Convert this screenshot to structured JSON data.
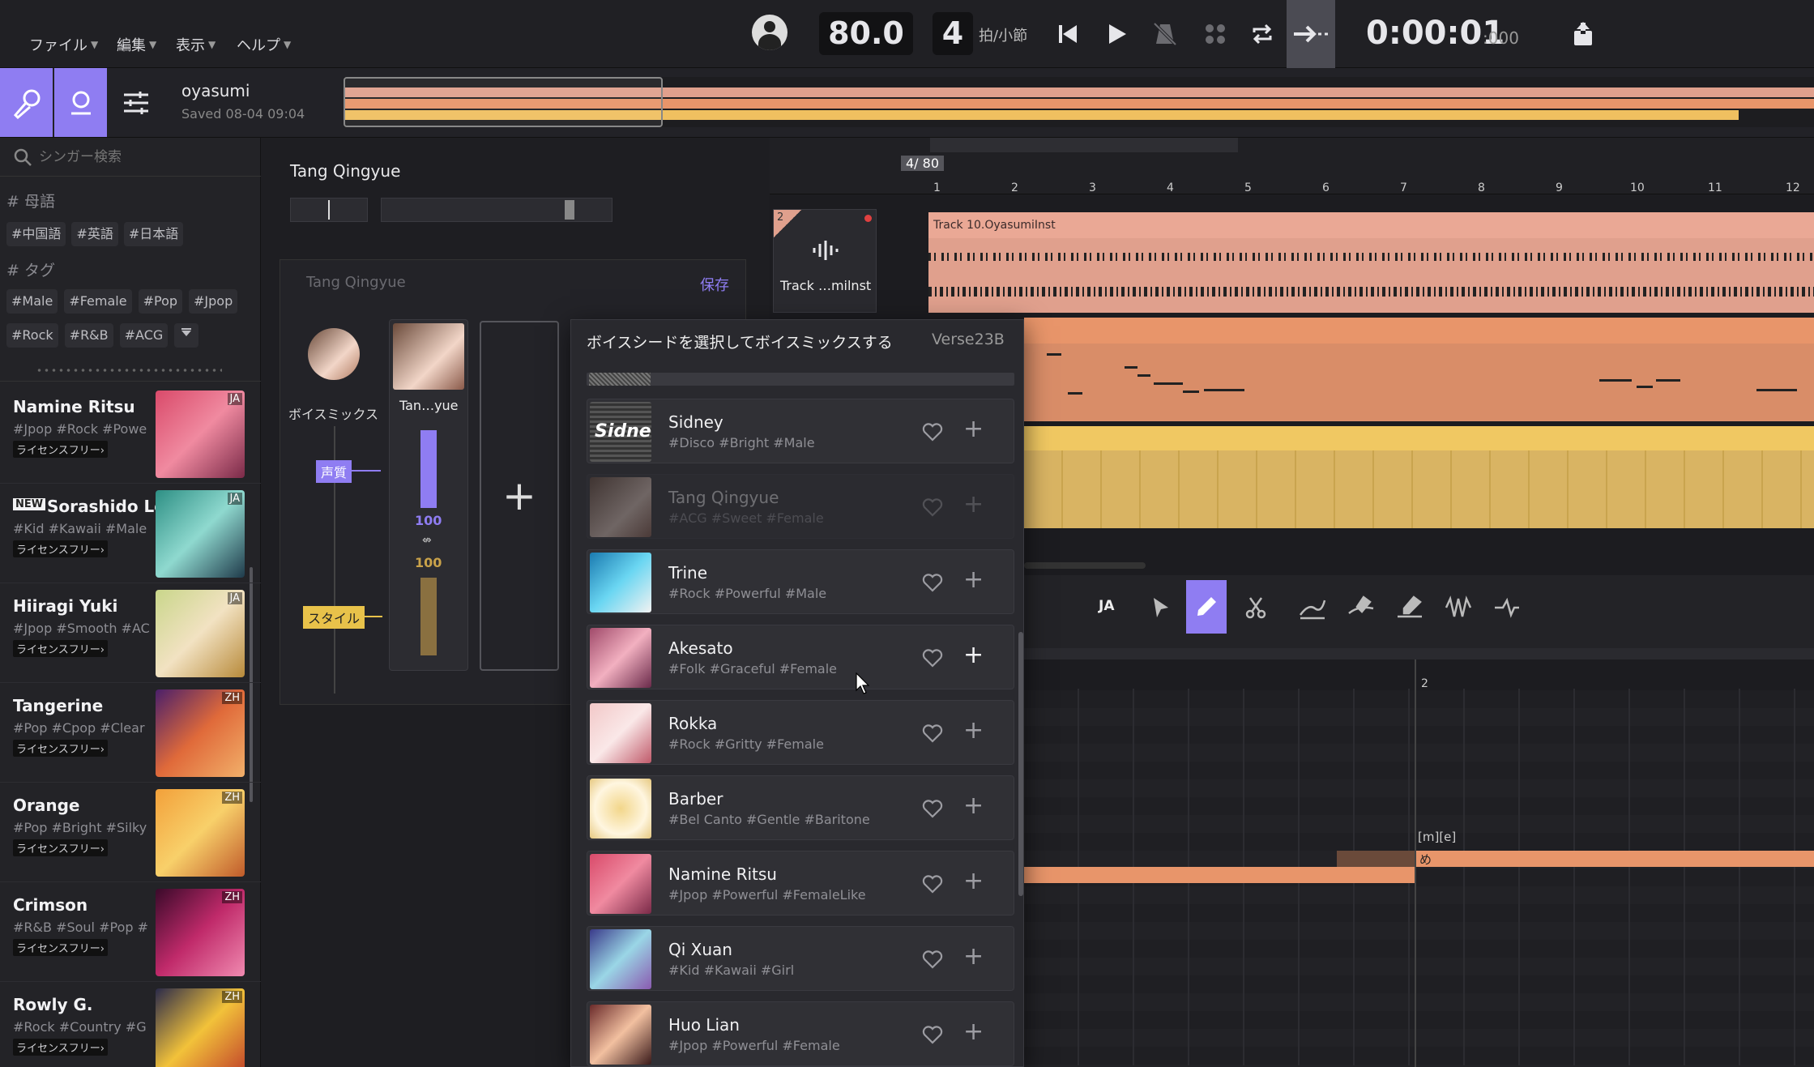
{
  "menu": {
    "file": "ファイル",
    "edit": "編集",
    "view": "表示",
    "help": "ヘルプ"
  },
  "transport": {
    "tempo": "80.0",
    "beats": "4",
    "beats_unit": "拍/小節",
    "time": "0:00:01",
    "time_sub": ":000"
  },
  "project": {
    "title": "oyasumi",
    "saved": "Saved 08-04 09:04"
  },
  "search": {
    "placeholder": "シンガー検索"
  },
  "filters": {
    "language_heading": "# 母語",
    "languages": [
      "#中国語",
      "#英語",
      "#日本語"
    ],
    "tag_heading": "# タグ",
    "tags_row1": [
      "#Male",
      "#Female",
      "#Pop",
      "#Jpop"
    ],
    "tags_row2": [
      "#Rock",
      "#R&B",
      "#ACG"
    ]
  },
  "singers": [
    {
      "name": "Namine Ritsu",
      "tags": "#Jpop #Rock #Powe",
      "license": "ライセンスフリー›",
      "lang": "JA",
      "new": ""
    },
    {
      "name": "Sorashido Le",
      "tags": "#Kid #Kawaii #Male",
      "license": "ライセンスフリー›",
      "lang": "JA",
      "new": "NEW"
    },
    {
      "name": "Hiiragi Yuki",
      "tags": "#Jpop #Smooth #AC",
      "license": "ライセンスフリー›",
      "lang": "JA",
      "new": ""
    },
    {
      "name": "Tangerine",
      "tags": "#Pop #Cpop #Clear",
      "license": "ライセンスフリー›",
      "lang": "ZH",
      "new": ""
    },
    {
      "name": "Orange",
      "tags": "#Pop #Bright #Silky",
      "license": "ライセンスフリー›",
      "lang": "ZH",
      "new": ""
    },
    {
      "name": "Crimson",
      "tags": "#R&B #Soul #Pop #",
      "license": "ライセンスフリー›",
      "lang": "ZH",
      "new": ""
    },
    {
      "name": "Rowly G.",
      "tags": "#Rock #Country #G",
      "license": "ライセンスフリー›",
      "lang": "ZH",
      "new": ""
    }
  ],
  "mixer": {
    "singer_title": "Tang Qingyue",
    "card_title": "Tang Qingyue",
    "save": "保存",
    "voicemix_label": "ボイスミックス",
    "voice_name": "Tan…yue",
    "quality_label": "声質",
    "style_label": "スタイル",
    "quality_value": "100",
    "style_value": "100",
    "add_symbol": "+"
  },
  "tracks": {
    "position": "4/",
    "tempo_marker": "80",
    "bars": [
      "1",
      "2",
      "3",
      "4",
      "5",
      "6",
      "7",
      "8",
      "9",
      "10",
      "11",
      "12"
    ],
    "track_number": "2",
    "track_label": "Track …milnst",
    "clip_label": "Track 10.OyasumiInst"
  },
  "popup": {
    "title": "ボイスシードを選択してボイスミックスする",
    "version": "Verse23B",
    "voices": [
      {
        "name": "Sidney",
        "tags": "#Disco #Bright #Male",
        "disabled": false
      },
      {
        "name": "Tang Qingyue",
        "tags": "#ACG #Sweet #Female",
        "disabled": true
      },
      {
        "name": "Trine",
        "tags": "#Rock #Powerful #Male",
        "disabled": false
      },
      {
        "name": "Akesato",
        "tags": "#Folk #Graceful #Female",
        "disabled": false
      },
      {
        "name": "Rokka",
        "tags": "#Rock #Gritty #Female",
        "disabled": false
      },
      {
        "name": "Barber",
        "tags": "#Bel Canto #Gentle #Baritone",
        "disabled": false
      },
      {
        "name": "Namine Ritsu",
        "tags": "#Jpop #Powerful #FemaleLike",
        "disabled": false
      },
      {
        "name": "Qi Xuan",
        "tags": "#Kid #Kawaii #Girl",
        "disabled": false
      },
      {
        "name": "Huo Lian",
        "tags": "#Jpop #Powerful #Female",
        "disabled": false
      }
    ]
  },
  "editor": {
    "lang": "JA",
    "bar_marker": "2",
    "phoneme": "[m][e]",
    "lyric": "め"
  },
  "colors": {
    "accent": "#8f7df2",
    "track_salmon": "#e0a08d",
    "track_orange": "#e8956a",
    "track_yellow": "#d9b463"
  }
}
